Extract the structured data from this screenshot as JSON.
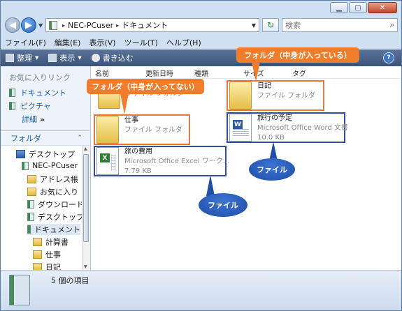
{
  "address": {
    "root_sep": "▸",
    "crumbs": [
      "NEC-PCuser",
      "ドキュメント"
    ]
  },
  "search": {
    "placeholder": "検索"
  },
  "menubar": [
    "ファイル(F)",
    "編集(E)",
    "表示(V)",
    "ツール(T)",
    "ヘルプ(H)"
  ],
  "toolbar": {
    "organize": "整理",
    "views": "表示",
    "burn": "書き込む"
  },
  "favorites": {
    "header": "お気に入りリンク",
    "items": [
      "ドキュメント",
      "ピクチャ"
    ],
    "more": "詳細",
    "more_glyph": "»"
  },
  "folders": {
    "header": "フォルダ",
    "tree": [
      {
        "label": "デスクトップ",
        "icon": "desktop-icon"
      },
      {
        "label": "NEC-PCuser",
        "icon": "user-folder-icon"
      },
      {
        "label": "アドレス帳",
        "icon": "folder-icon"
      },
      {
        "label": "お気に入り",
        "icon": "folder-icon"
      },
      {
        "label": "ダウンロード",
        "icon": "folder-icon"
      },
      {
        "label": "デスクトップ",
        "icon": "folder-icon"
      },
      {
        "label": "ドキュメント",
        "icon": "folder-icon",
        "selected": true
      },
      {
        "label": "計算書",
        "icon": "folder-icon"
      },
      {
        "label": "仕事",
        "icon": "folder-icon"
      },
      {
        "label": "日記",
        "icon": "folder-icon"
      }
    ]
  },
  "columns": [
    "名前",
    "更新日時",
    "種類",
    "サイズ",
    "タグ"
  ],
  "files": [
    {
      "name": "",
      "type": "ファイル フォルダ",
      "kind": "folder"
    },
    {
      "name": "日記",
      "type": "ファイル フォルダ",
      "kind": "folder"
    },
    {
      "name": "仕事",
      "type": "ファイル フォルダ",
      "kind": "folder"
    },
    {
      "name": "旅行の予定",
      "type": "Microsoft Office Word 文書",
      "size": "10.0 KB",
      "kind": "word"
    },
    {
      "name": "旅の費用",
      "type": "Microsoft Office Excel ワーク...",
      "size": "7.79 KB",
      "kind": "excel"
    }
  ],
  "callouts": {
    "folder_with_content": "フォルダ（中身が入っている）",
    "folder_empty": "フォルダ（中身が入ってない）",
    "file1": "ファイル",
    "file2": "ファイル"
  },
  "status": {
    "count": "5 個の項目"
  },
  "colors": {
    "callout_orange": "#ef7d2c",
    "callout_blue": "#1e4ea6",
    "toolbar": "#4a6389"
  }
}
